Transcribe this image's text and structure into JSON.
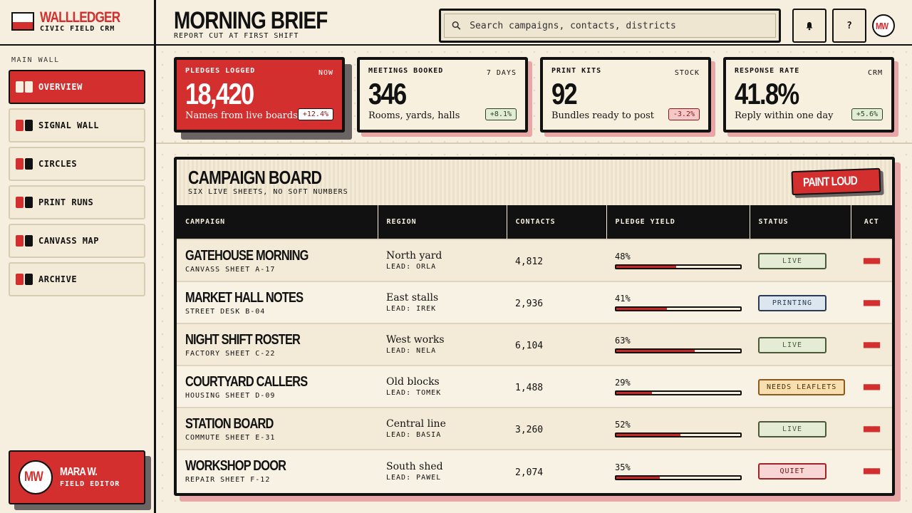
{
  "brand": {
    "name": "WALLLEDGER",
    "subtitle": "CIVIC FIELD CRM"
  },
  "sidebar": {
    "section_label": "MAIN WALL",
    "items": [
      {
        "label": "OVERVIEW",
        "active": true
      },
      {
        "label": "SIGNAL WALL",
        "active": false
      },
      {
        "label": "CIRCLES",
        "active": false
      },
      {
        "label": "PRINT RUNS",
        "active": false
      },
      {
        "label": "CANVASS MAP",
        "active": false
      },
      {
        "label": "ARCHIVE",
        "active": false
      }
    ]
  },
  "profile": {
    "initials": "MW",
    "name": "MARA W.",
    "role": "FIELD EDITOR"
  },
  "header": {
    "title": "MORNING BRIEF",
    "subtitle": "REPORT CUT AT FIRST SHIFT",
    "search_placeholder": "Search campaigns, contacts, districts",
    "help_label": "?",
    "avatar_initials": "MW"
  },
  "stats": [
    {
      "label": "PLEDGES LOGGED",
      "period": "NOW",
      "value": "18,420",
      "caption": "Names from live boards",
      "delta": "+12.4%"
    },
    {
      "label": "MEETINGS BOOKED",
      "period": "7 DAYS",
      "value": "346",
      "caption": "Rooms, yards, halls",
      "delta": "+8.1%"
    },
    {
      "label": "PRINT KITS",
      "period": "STOCK",
      "value": "92",
      "caption": "Bundles ready to post",
      "delta": "-3.2%"
    },
    {
      "label": "RESPONSE RATE",
      "period": "CRM",
      "value": "41.8%",
      "caption": "Reply within one day",
      "delta": "+5.6%"
    }
  ],
  "board": {
    "title": "CAMPAIGN BOARD",
    "subtitle": "SIX LIVE SHEETS, NO SOFT NUMBERS",
    "action_label": "PAINT LOUD",
    "columns": [
      "CAMPAIGN",
      "REGION",
      "CONTACTS",
      "PLEDGE YIELD",
      "STATUS",
      "ACT"
    ],
    "rows": [
      {
        "name": "GATEHOUSE MORNING",
        "sheet": "CANVASS SHEET A-17",
        "region": "North yard",
        "lead": "LEAD: ORLA",
        "contacts": "4,812",
        "yield": "48%",
        "yield_pct": 48,
        "status": "LIVE",
        "status_type": "live",
        "act": "■■■"
      },
      {
        "name": "MARKET HALL NOTES",
        "sheet": "STREET DESK B-04",
        "region": "East stalls",
        "lead": "LEAD: IREK",
        "contacts": "2,936",
        "yield": "41%",
        "yield_pct": 41,
        "status": "PRINTING",
        "status_type": "printing",
        "act": "■■■"
      },
      {
        "name": "NIGHT SHIFT ROSTER",
        "sheet": "FACTORY SHEET C-22",
        "region": "West works",
        "lead": "LEAD: NELA",
        "contacts": "6,104",
        "yield": "63%",
        "yield_pct": 63,
        "status": "LIVE",
        "status_type": "live",
        "act": "■■■"
      },
      {
        "name": "COURTYARD CALLERS",
        "sheet": "HOUSING SHEET D-09",
        "region": "Old blocks",
        "lead": "LEAD: TOMEK",
        "contacts": "1,488",
        "yield": "29%",
        "yield_pct": 29,
        "status": "NEEDS LEAFLETS",
        "status_type": "needs",
        "act": "■■■"
      },
      {
        "name": "STATION BOARD",
        "sheet": "COMMUTE SHEET E-31",
        "region": "Central line",
        "lead": "LEAD: BASIA",
        "contacts": "3,260",
        "yield": "52%",
        "yield_pct": 52,
        "status": "LIVE",
        "status_type": "live",
        "act": "■■■"
      },
      {
        "name": "WORKSHOP DOOR",
        "sheet": "REPAIR SHEET F-12",
        "region": "South shed",
        "lead": "LEAD: PAWEL",
        "contacts": "2,074",
        "yield": "35%",
        "yield_pct": 35,
        "status": "QUIET",
        "status_type": "quiet",
        "act": "■■■"
      }
    ]
  },
  "colors": {
    "accent": "#d32f2f",
    "ink": "#111111",
    "paper": "#f6efdf"
  }
}
